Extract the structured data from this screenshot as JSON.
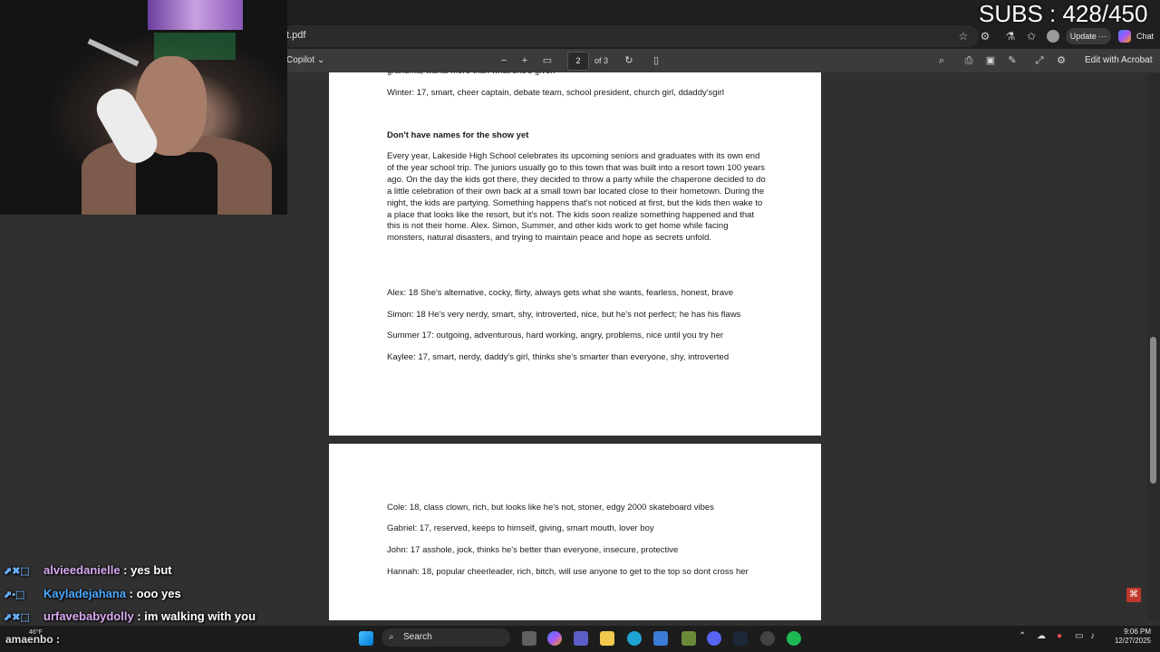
{
  "overlay": {
    "subs": "SUBS : 428/450"
  },
  "browser": {
    "address": "t.pdf",
    "update_label": "Update",
    "update_more": "···",
    "chat_label": "Chat"
  },
  "pdf_toolbar": {
    "copilot_label": "Copilot",
    "page_number": "2",
    "page_total": "of 3",
    "edit_label": "Edit with Acrobat"
  },
  "page1": {
    "cut_line": "grandma, wants more than what she's given",
    "winter": "Winter: 17, smart, cheer captain, debate team, school president, church girl, ddaddy'sgirl",
    "heading": "Don't have names for the show yet",
    "paragraph": "Every year, Lakeside High School celebrates its upcoming seniors and graduates with its own end of the year school trip. The juniors usually go to this town that was built into a resort town 100 years ago. On the day the kids got there, they decided to throw a party while the chaperone decided to do a little celebration of their own back at a small town bar located close to their hometown. During the night, the kids are partying. Something happens that's not noticed at first, but the kids then wake to a place that looks like the resort, but it's not. The kids soon realize something happened and that this is not their home. Alex.  Simon, Summer, and other kids work to get home while facing monsters, natural disasters, and trying to maintain peace and hope as secrets unfold.",
    "characters": [
      "Alex: 18 She's alternative, cocky, flirty, always gets what she wants, fearless, honest, brave",
      "Simon: 18 He's very nerdy, smart, shy, introverted, nice, but he's not perfect; he has his flaws",
      "Summer 17: outgoing, adventurous, hard working, angry, problems, nice until you try her",
      "Kaylee: 17, smart, nerdy, daddy's girl, thinks she's smarter than everyone, shy, introverted"
    ]
  },
  "page2": {
    "characters": [
      "Cole: 18, class clown, rich, but looks like he's not, stoner, edgy 2000 skateboard vibes",
      "Gabriel: 17, reserved, keeps to himself, giving, smart mouth, lover boy",
      "John: 17 asshole, jock, thinks he's better than everyone, insecure, protective",
      "Hannah: 18, popular cheerleader, rich, bitch, will use anyone to get to the top so dont cross her"
    ]
  },
  "chat": [
    {
      "user": "alvieedanielle",
      "message": " : yes but",
      "color": "#d8a8f0"
    },
    {
      "user": "Kayladejahana",
      "message": " : ooo yes",
      "color": "#4aa8ff"
    },
    {
      "user": "urfavebabydolly",
      "message": " : im walking with you",
      "color": "#d8a8f0"
    },
    {
      "user": "amaenbo",
      "message": " :",
      "color": "#e0e0e0"
    }
  ],
  "taskbar": {
    "search_label": "Search",
    "temperature": "46°F",
    "time": "9:06 PM",
    "date": "12/27/2025"
  }
}
